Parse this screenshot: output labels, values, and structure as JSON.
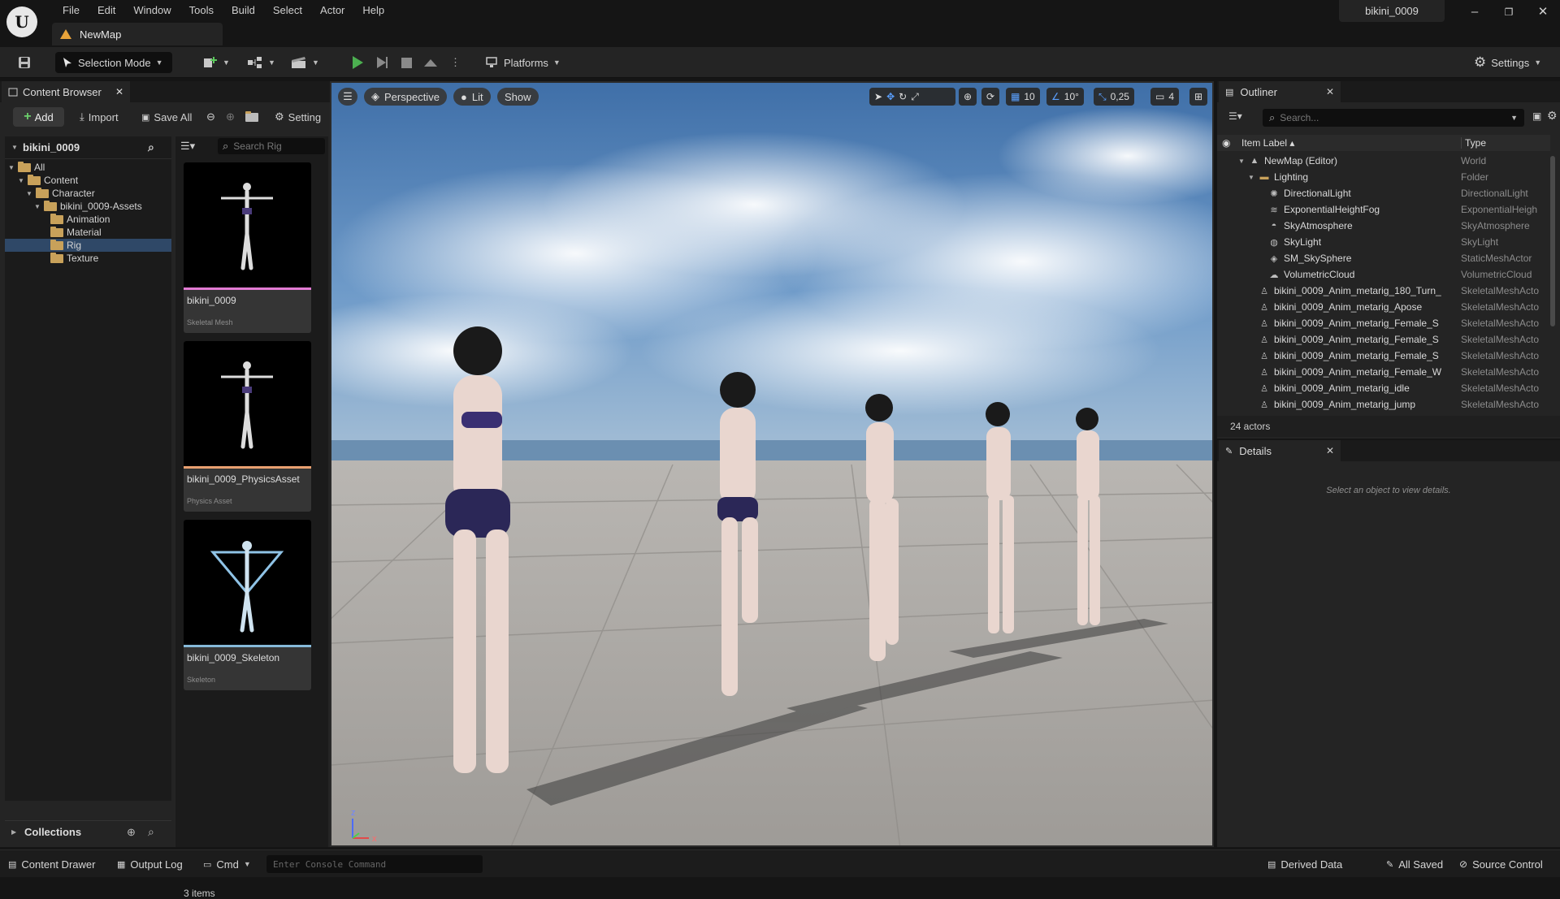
{
  "app": {
    "menu": [
      "File",
      "Edit",
      "Window",
      "Tools",
      "Build",
      "Select",
      "Actor",
      "Help"
    ],
    "document_tab": "NewMap",
    "project_name": "bikini_0009"
  },
  "toolbar": {
    "selection_mode": "Selection Mode",
    "platforms": "Platforms",
    "settings": "Settings"
  },
  "content_browser": {
    "tab": "Content Browser",
    "add": "Add",
    "import": "Import",
    "save_all": "Save All",
    "settings": "Setting",
    "root": "bikini_0009",
    "search_placeholder": "Search Rig",
    "tree": [
      {
        "label": "All",
        "depth": 0,
        "expanded": true
      },
      {
        "label": "Content",
        "depth": 1,
        "expanded": true
      },
      {
        "label": "Character",
        "depth": 2,
        "expanded": true
      },
      {
        "label": "bikini_0009-Assets",
        "depth": 3,
        "expanded": true
      },
      {
        "label": "Animation",
        "depth": 4
      },
      {
        "label": "Material",
        "depth": 4
      },
      {
        "label": "Rig",
        "depth": 4,
        "selected": true
      },
      {
        "label": "Texture",
        "depth": 4
      }
    ],
    "assets": [
      {
        "name": "bikini_0009",
        "type": "Skeletal Mesh",
        "color": "#e27bd3"
      },
      {
        "name": "bikini_0009_PhysicsAsset",
        "type": "Physics Asset",
        "color": "#e8a070"
      },
      {
        "name": "bikini_0009_Skeleton",
        "type": "Skeleton",
        "color": "#86b9d9"
      }
    ],
    "item_count": "3 items",
    "collections": "Collections"
  },
  "viewport": {
    "perspective": "Perspective",
    "lit": "Lit",
    "show": "Show",
    "grid_snap": "10",
    "rot_snap": "10°",
    "scale_snap": "0,25",
    "camera_speed": "4"
  },
  "outliner": {
    "tab": "Outliner",
    "search_placeholder": "Search...",
    "col_label": "Item Label",
    "col_type": "Type",
    "rows": [
      {
        "label": "NewMap (Editor)",
        "type": "World",
        "indent": 1,
        "arrow": "down",
        "icon": "world-icon"
      },
      {
        "label": "Lighting",
        "type": "Folder",
        "indent": 2,
        "arrow": "down",
        "icon": "folder-icon"
      },
      {
        "label": "DirectionalLight",
        "type": "DirectionalLight",
        "indent": 3,
        "icon": "sun-icon"
      },
      {
        "label": "ExponentialHeightFog",
        "type": "ExponentialHeigh",
        "indent": 3,
        "icon": "fog-icon"
      },
      {
        "label": "SkyAtmosphere",
        "type": "SkyAtmosphere",
        "indent": 3,
        "icon": "atmosphere-icon"
      },
      {
        "label": "SkyLight",
        "type": "SkyLight",
        "indent": 3,
        "icon": "skylight-icon"
      },
      {
        "label": "SM_SkySphere",
        "type": "StaticMeshActor",
        "indent": 3,
        "icon": "mesh-icon"
      },
      {
        "label": "VolumetricCloud",
        "type": "VolumetricCloud",
        "indent": 3,
        "icon": "cloud-icon"
      },
      {
        "label": "bikini_0009_Anim_metarig_180_Turn_",
        "type": "SkeletalMeshActo",
        "indent": 2,
        "icon": "skeletal-icon"
      },
      {
        "label": "bikini_0009_Anim_metarig_Apose",
        "type": "SkeletalMeshActo",
        "indent": 2,
        "icon": "skeletal-icon"
      },
      {
        "label": "bikini_0009_Anim_metarig_Female_S",
        "type": "SkeletalMeshActo",
        "indent": 2,
        "icon": "skeletal-icon"
      },
      {
        "label": "bikini_0009_Anim_metarig_Female_S",
        "type": "SkeletalMeshActo",
        "indent": 2,
        "icon": "skeletal-icon"
      },
      {
        "label": "bikini_0009_Anim_metarig_Female_S",
        "type": "SkeletalMeshActo",
        "indent": 2,
        "icon": "skeletal-icon"
      },
      {
        "label": "bikini_0009_Anim_metarig_Female_W",
        "type": "SkeletalMeshActo",
        "indent": 2,
        "icon": "skeletal-icon"
      },
      {
        "label": "bikini_0009_Anim_metarig_idle",
        "type": "SkeletalMeshActo",
        "indent": 2,
        "icon": "skeletal-icon"
      },
      {
        "label": "bikini_0009_Anim_metarig_jump",
        "type": "SkeletalMeshActo",
        "indent": 2,
        "icon": "skeletal-icon"
      }
    ],
    "actor_count": "24 actors"
  },
  "details": {
    "tab": "Details",
    "empty_message": "Select an object to view details."
  },
  "statusbar": {
    "content_drawer": "Content Drawer",
    "output_log": "Output Log",
    "cmd": "Cmd",
    "console_placeholder": "Enter Console Command",
    "derived_data": "Derived Data",
    "all_saved": "All Saved",
    "source_control": "Source Control"
  }
}
